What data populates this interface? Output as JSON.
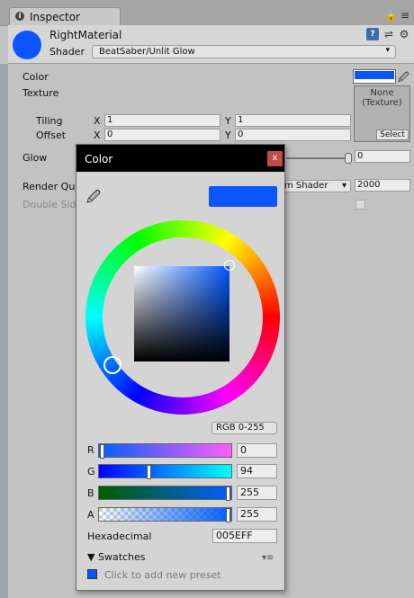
{
  "tab": {
    "icon": "i",
    "label": "Inspector"
  },
  "header": {
    "material_name": "RightMaterial",
    "shader_label": "Shader",
    "shader_value": "BeatSaber/Unlit Glow",
    "material_color": "#0A55FF"
  },
  "props": {
    "color_label": "Color",
    "texture_label": "Texture",
    "texture_none": "None",
    "texture_type": "(Texture)",
    "texture_select": "Select",
    "tiling_label": "Tiling",
    "offset_label": "Offset",
    "tiling_x": "1",
    "tiling_y": "1",
    "offset_x": "0",
    "offset_y": "0",
    "axis_x": "X",
    "axis_y": "Y",
    "glow_label": "Glow",
    "glow_value": "0",
    "render_queue_label": "Render Qu",
    "render_queue_dropdown": "m Shader",
    "render_queue_value": "2000",
    "double_sided_label": "Double Sid"
  },
  "color_window": {
    "title": "Color",
    "close": "x",
    "mode": "RGB 0-255",
    "channels": [
      {
        "label": "R",
        "value": "0"
      },
      {
        "label": "G",
        "value": "94"
      },
      {
        "label": "B",
        "value": "255"
      },
      {
        "label": "A",
        "value": "255"
      }
    ],
    "hex_label": "Hexadecimal",
    "hex_value": "005EFF",
    "swatches_label": "Swatches",
    "swatches_hint": "Click to add new preset",
    "preview_color": "#005EFF"
  }
}
